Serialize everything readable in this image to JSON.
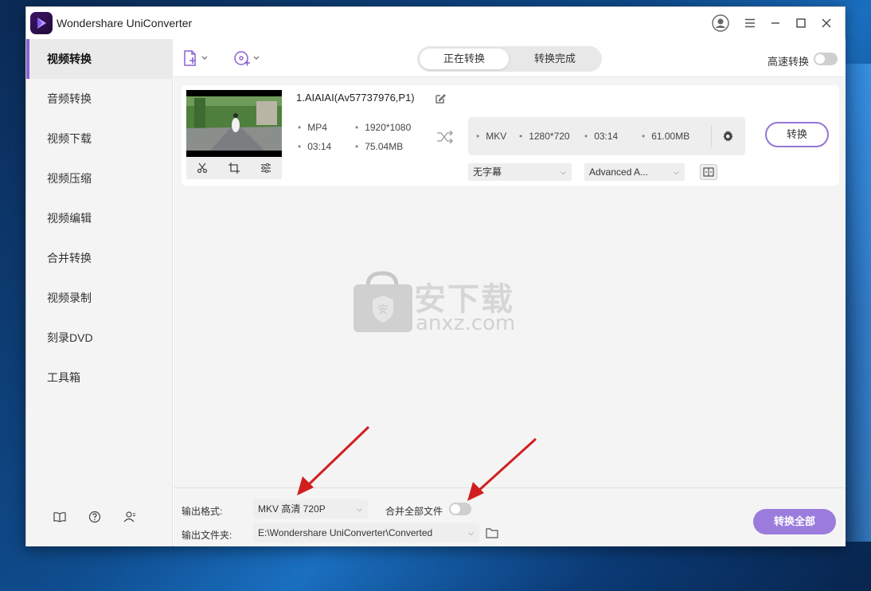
{
  "app": {
    "title": "Wondershare UniConverter"
  },
  "sidebar": {
    "items": [
      {
        "label": "视频转换",
        "active": true
      },
      {
        "label": "音频转换"
      },
      {
        "label": "视频下载"
      },
      {
        "label": "视频压缩"
      },
      {
        "label": "视频编辑"
      },
      {
        "label": "合并转换"
      },
      {
        "label": "视频录制"
      },
      {
        "label": "刻录DVD"
      },
      {
        "label": "工具箱"
      }
    ],
    "footer_icons": [
      "book-icon",
      "help-icon",
      "account-icon"
    ]
  },
  "toolbar": {
    "tabs": [
      {
        "label": "正在转换",
        "active": true
      },
      {
        "label": "转换完成"
      }
    ],
    "high_speed_label": "高速转换",
    "high_speed_on": false
  },
  "file": {
    "name": "1.AIAIAI(Av57737976,P1)",
    "source": {
      "format": "MP4",
      "resolution": "1920*1080",
      "duration": "03:14",
      "size": "75.04MB"
    },
    "target": {
      "format": "MKV",
      "resolution": "1280*720",
      "duration": "03:14",
      "size": "61.00MB"
    },
    "subtitle": "无字幕",
    "audio": "Advanced A...",
    "convert_label": "转换"
  },
  "watermark": {
    "text": "安下载",
    "sub": "anxz.com"
  },
  "bottom": {
    "format_label": "输出格式:",
    "format_value": "MKV 高清 720P",
    "merge_label": "合并全部文件",
    "merge_on": false,
    "folder_label": "输出文件夹:",
    "folder_value": "E:\\Wondershare UniConverter\\Converted",
    "convert_all_label": "转换全部"
  },
  "colors": {
    "accent": "#9b7bdc",
    "arrow": "#d11f1f",
    "sidebar_active": "#8a63d2"
  }
}
